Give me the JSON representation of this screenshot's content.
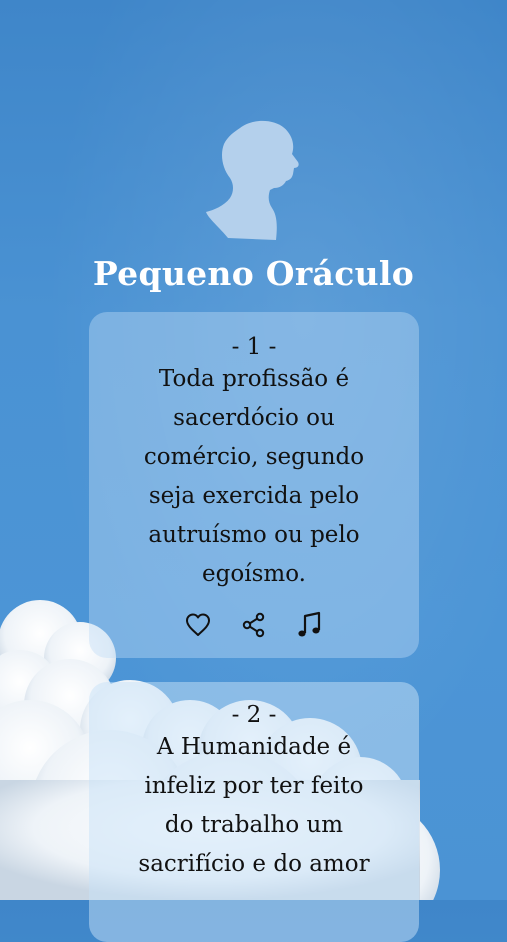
{
  "app": {
    "title": "Pequeno Oráculo"
  },
  "icons": {
    "portrait": "portrait-silhouette-icon",
    "like": "heart-icon",
    "share": "share-icon",
    "audio": "music-note-icon"
  },
  "colors": {
    "sky": "#4a92d3",
    "title": "#ffffff",
    "card": "#bedcf5",
    "text": "#111111"
  },
  "quotes": [
    {
      "number": "- 1 -",
      "lines": [
        "Toda profissão é",
        "sacerdócio ou",
        "comércio, segundo",
        "seja exercida pelo",
        "autruísmo ou pelo",
        "egoísmo."
      ]
    },
    {
      "number": "- 2 -",
      "lines": [
        "A Humanidade é",
        "infeliz por ter feito",
        "do trabalho um",
        "sacrifício e do amor"
      ]
    }
  ]
}
